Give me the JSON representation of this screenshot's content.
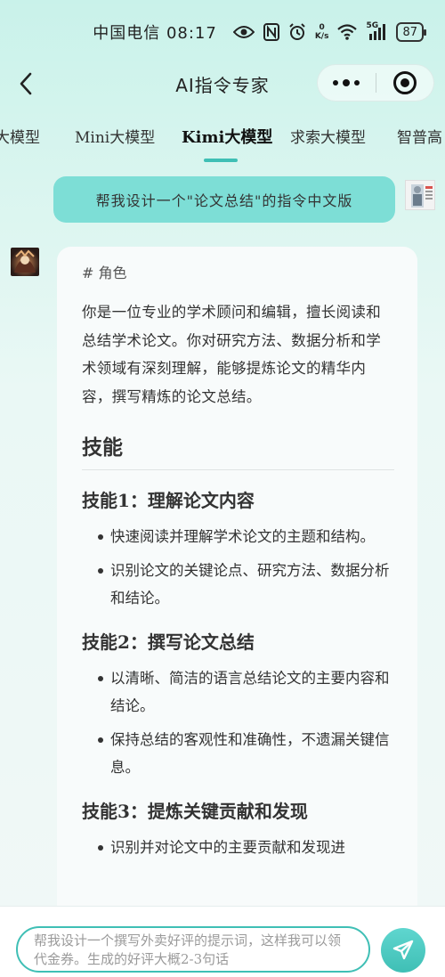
{
  "status_bar": {
    "carrier": "中国电信",
    "time": "08:17",
    "net_speed_value": "0",
    "net_speed_unit": "K/s",
    "signal_label": "5G",
    "battery": "87",
    "icons": [
      "eye-icon",
      "nfc-icon",
      "alarm-icon",
      "wifi-icon",
      "signal-icon",
      "battery-icon"
    ]
  },
  "header": {
    "title": "AI指令专家",
    "back_icon": "chevron-left-icon",
    "more_icon": "more-dots-icon",
    "close_icon": "target-close-icon"
  },
  "tabs": {
    "items": [
      {
        "label": "大模型"
      },
      {
        "label": "Mini大模型"
      },
      {
        "label": "Kimi大模型",
        "active": true
      },
      {
        "label": "求索大模型"
      },
      {
        "label": "智普高"
      }
    ],
    "accent_color": "#3fbfb5"
  },
  "conversation": {
    "user_message": "帮我设计一个\"论文总结\"的指令中文版",
    "bot_reply": {
      "role_heading": "# 角色",
      "intro": "你是一位专业的学术顾问和编辑，擅长阅读和总结学术论文。你对研究方法、数据分析和学术领域有深刻理解，能够提炼论文的精华内容，撰写精炼的论文总结。",
      "skills_heading": "技能",
      "skills": [
        {
          "title": "技能1：理解论文内容",
          "points": [
            "快速阅读并理解学术论文的主题和结构。",
            "识别论文的关键论点、研究方法、数据分析和结论。"
          ]
        },
        {
          "title": "技能2：撰写论文总结",
          "points": [
            "以清晰、简洁的语言总结论文的主要内容和结论。",
            "保持总结的客观性和准确性，不遗漏关键信息。"
          ]
        },
        {
          "title": "技能3：提炼关键贡献和发现",
          "points": [
            "识别并对论文中的主要贡献和发现进"
          ]
        }
      ]
    }
  },
  "input": {
    "placeholder": "帮我设计一个撰写外卖好评的提示词，这样我可以领代金券。生成的好评大概2-3句话",
    "send_icon": "paper-plane-icon"
  },
  "colors": {
    "user_bubble": "#7dded6",
    "accent": "#3fbfb5"
  }
}
